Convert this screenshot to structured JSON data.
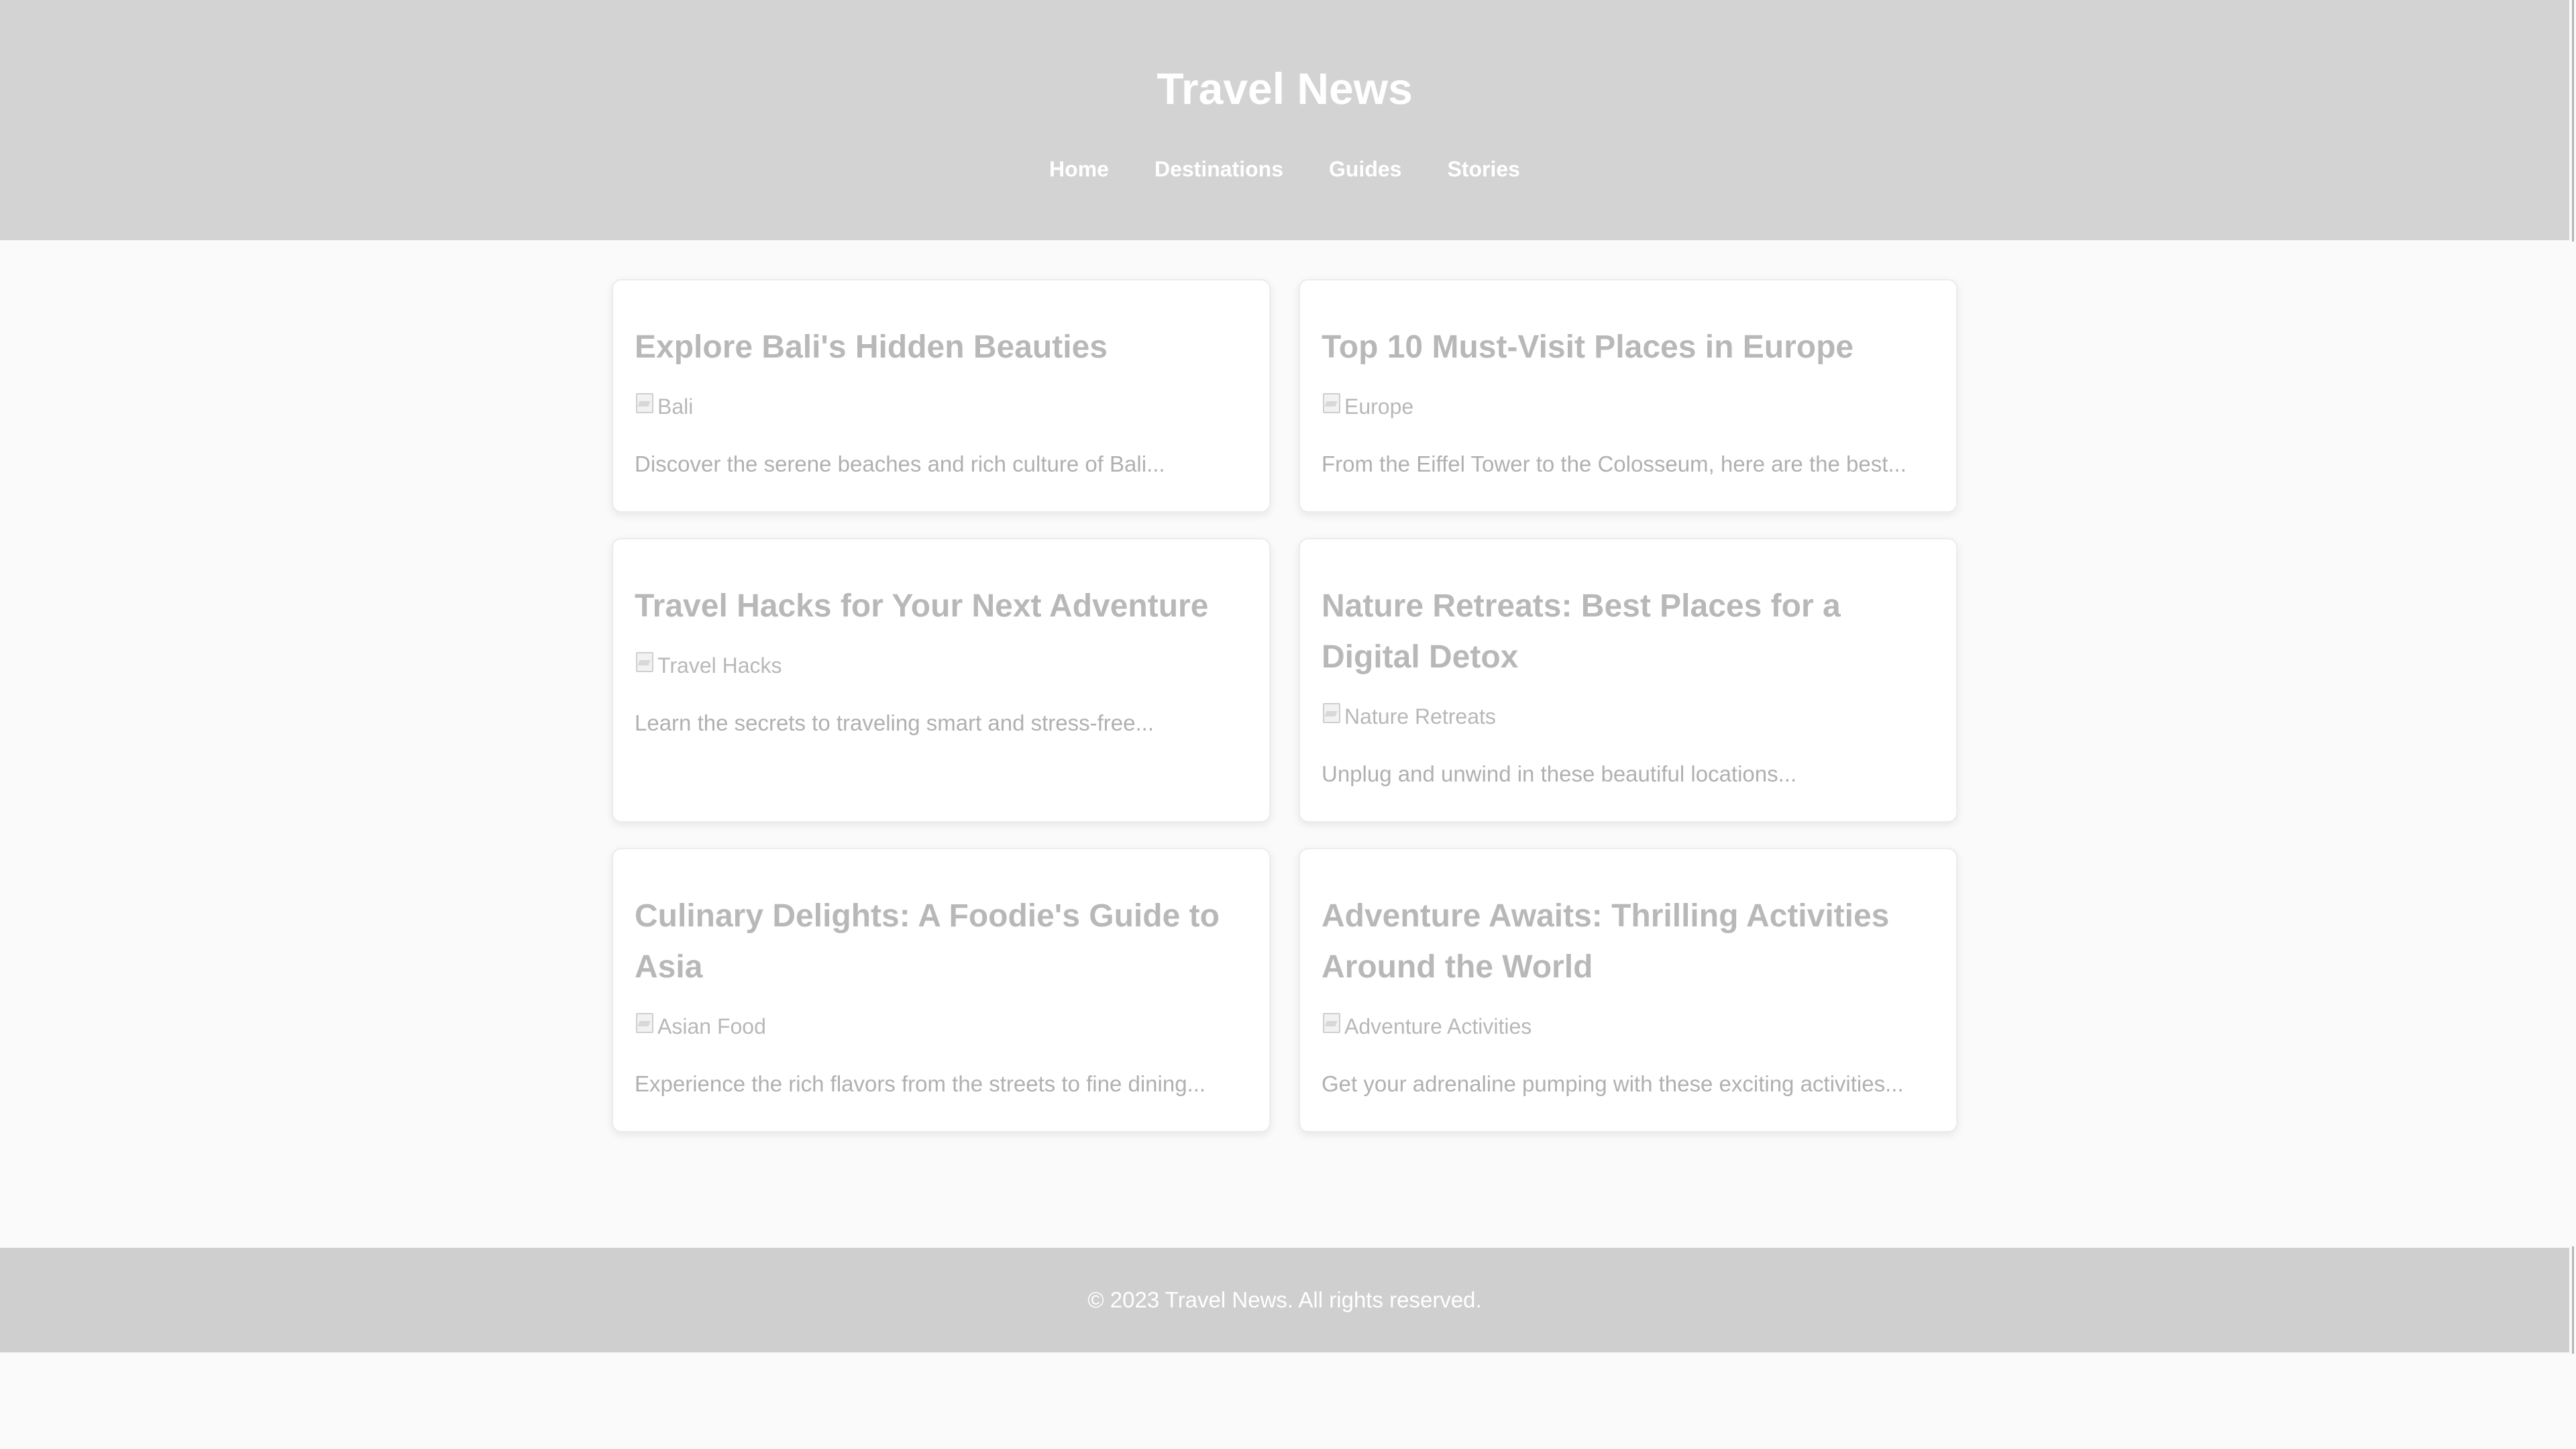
{
  "header": {
    "title": "Travel News",
    "nav": [
      "Home",
      "Destinations",
      "Guides",
      "Stories"
    ]
  },
  "articles": [
    {
      "title": "Explore Bali's Hidden Beauties",
      "image_alt": "Bali",
      "excerpt": "Discover the serene beaches and rich culture of Bali..."
    },
    {
      "title": "Top 10 Must-Visit Places in Europe",
      "image_alt": "Europe",
      "excerpt": "From the Eiffel Tower to the Colosseum, here are the best..."
    },
    {
      "title": "Travel Hacks for Your Next Adventure",
      "image_alt": "Travel Hacks",
      "excerpt": "Learn the secrets to traveling smart and stress-free..."
    },
    {
      "title": "Nature Retreats: Best Places for a Digital Detox",
      "image_alt": "Nature Retreats",
      "excerpt": "Unplug and unwind in these beautiful locations..."
    },
    {
      "title": "Culinary Delights: A Foodie's Guide to Asia",
      "image_alt": "Asian Food",
      "excerpt": "Experience the rich flavors from the streets to fine dining..."
    },
    {
      "title": "Adventure Awaits: Thrilling Activities Around the World",
      "image_alt": "Adventure Activities",
      "excerpt": "Get your adrenaline pumping with these exciting activities..."
    }
  ],
  "footer": {
    "text": "© 2023 Travel News. All rights reserved."
  },
  "colors": {
    "header_bg": "#d3d3d3",
    "footer_bg": "#cfcfcf",
    "page_bg": "#fafafa",
    "card_text": "#b8b8b8"
  }
}
